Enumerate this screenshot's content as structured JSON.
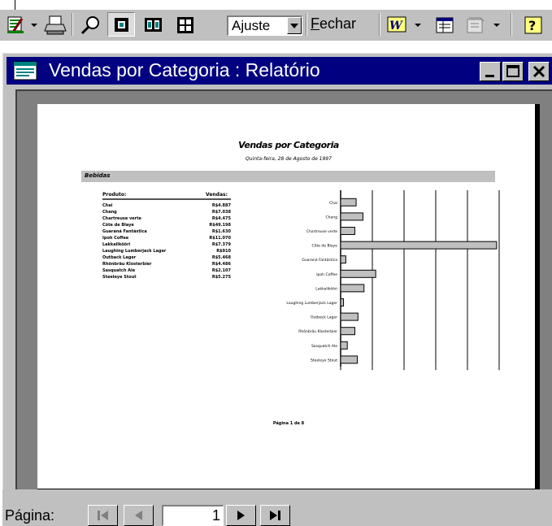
{
  "toolbar": {
    "zoom_value": "Ajuste",
    "close_label_underlined": "F",
    "close_label_rest": "echar",
    "icons": [
      "view-design-icon",
      "print-icon",
      "zoom-icon",
      "one-page-icon",
      "two-pages-icon",
      "multiple-pages-icon",
      "office-links-icon",
      "database-window-icon",
      "new-object-icon",
      "help-icon"
    ]
  },
  "window": {
    "title": "Vendas por Categoria : Relatório",
    "icon": "report-icon"
  },
  "report": {
    "title": "Vendas por Categoria",
    "date": "Quinta-feira, 28 de Agosto de 1997",
    "category": "Bebidas",
    "col_product": "Produto:",
    "col_sales": "Vendas:",
    "products": [
      {
        "name": "Chai",
        "value": "R$4.887"
      },
      {
        "name": "Chang",
        "value": "R$7.038"
      },
      {
        "name": "Chartreuse verte",
        "value": "R$4.475"
      },
      {
        "name": "Côte de Blaye",
        "value": "R$49.198"
      },
      {
        "name": "Guaraná Fantástica",
        "value": "R$1.630"
      },
      {
        "name": "Ipoh Coffee",
        "value": "R$11.070"
      },
      {
        "name": "Lakkalikööri",
        "value": "R$7.379"
      },
      {
        "name": "Laughing Lumberjack Lager",
        "value": "R$910"
      },
      {
        "name": "Outback Lager",
        "value": "R$5.468"
      },
      {
        "name": "Rhönbräu Klosterbier",
        "value": "R$4.486"
      },
      {
        "name": "Sasquatch Ale",
        "value": "R$2.107"
      },
      {
        "name": "Steeleye Stout",
        "value": "R$5.275"
      }
    ],
    "footer": "Página 1 de 8"
  },
  "chart_data": {
    "type": "bar",
    "orientation": "horizontal",
    "categories": [
      "Chai",
      "Chang",
      "Chartreuse verte",
      "Côte de Blaye",
      "Guaraná Fantástica",
      "Ipoh Coffee",
      "Lakkalikööri",
      "Laughing Lumberjack Lager",
      "Outback Lager",
      "Rhönbräu Klosterbier",
      "Sasquatch Ale",
      "Steeleye Stout"
    ],
    "values": [
      4887,
      7038,
      4475,
      49198,
      1630,
      11070,
      7379,
      910,
      5468,
      4486,
      2107,
      5275
    ],
    "xlim": [
      0,
      50000
    ],
    "grid": true,
    "legend": "none"
  },
  "navigation": {
    "label": "Página:",
    "current_page": "1"
  }
}
